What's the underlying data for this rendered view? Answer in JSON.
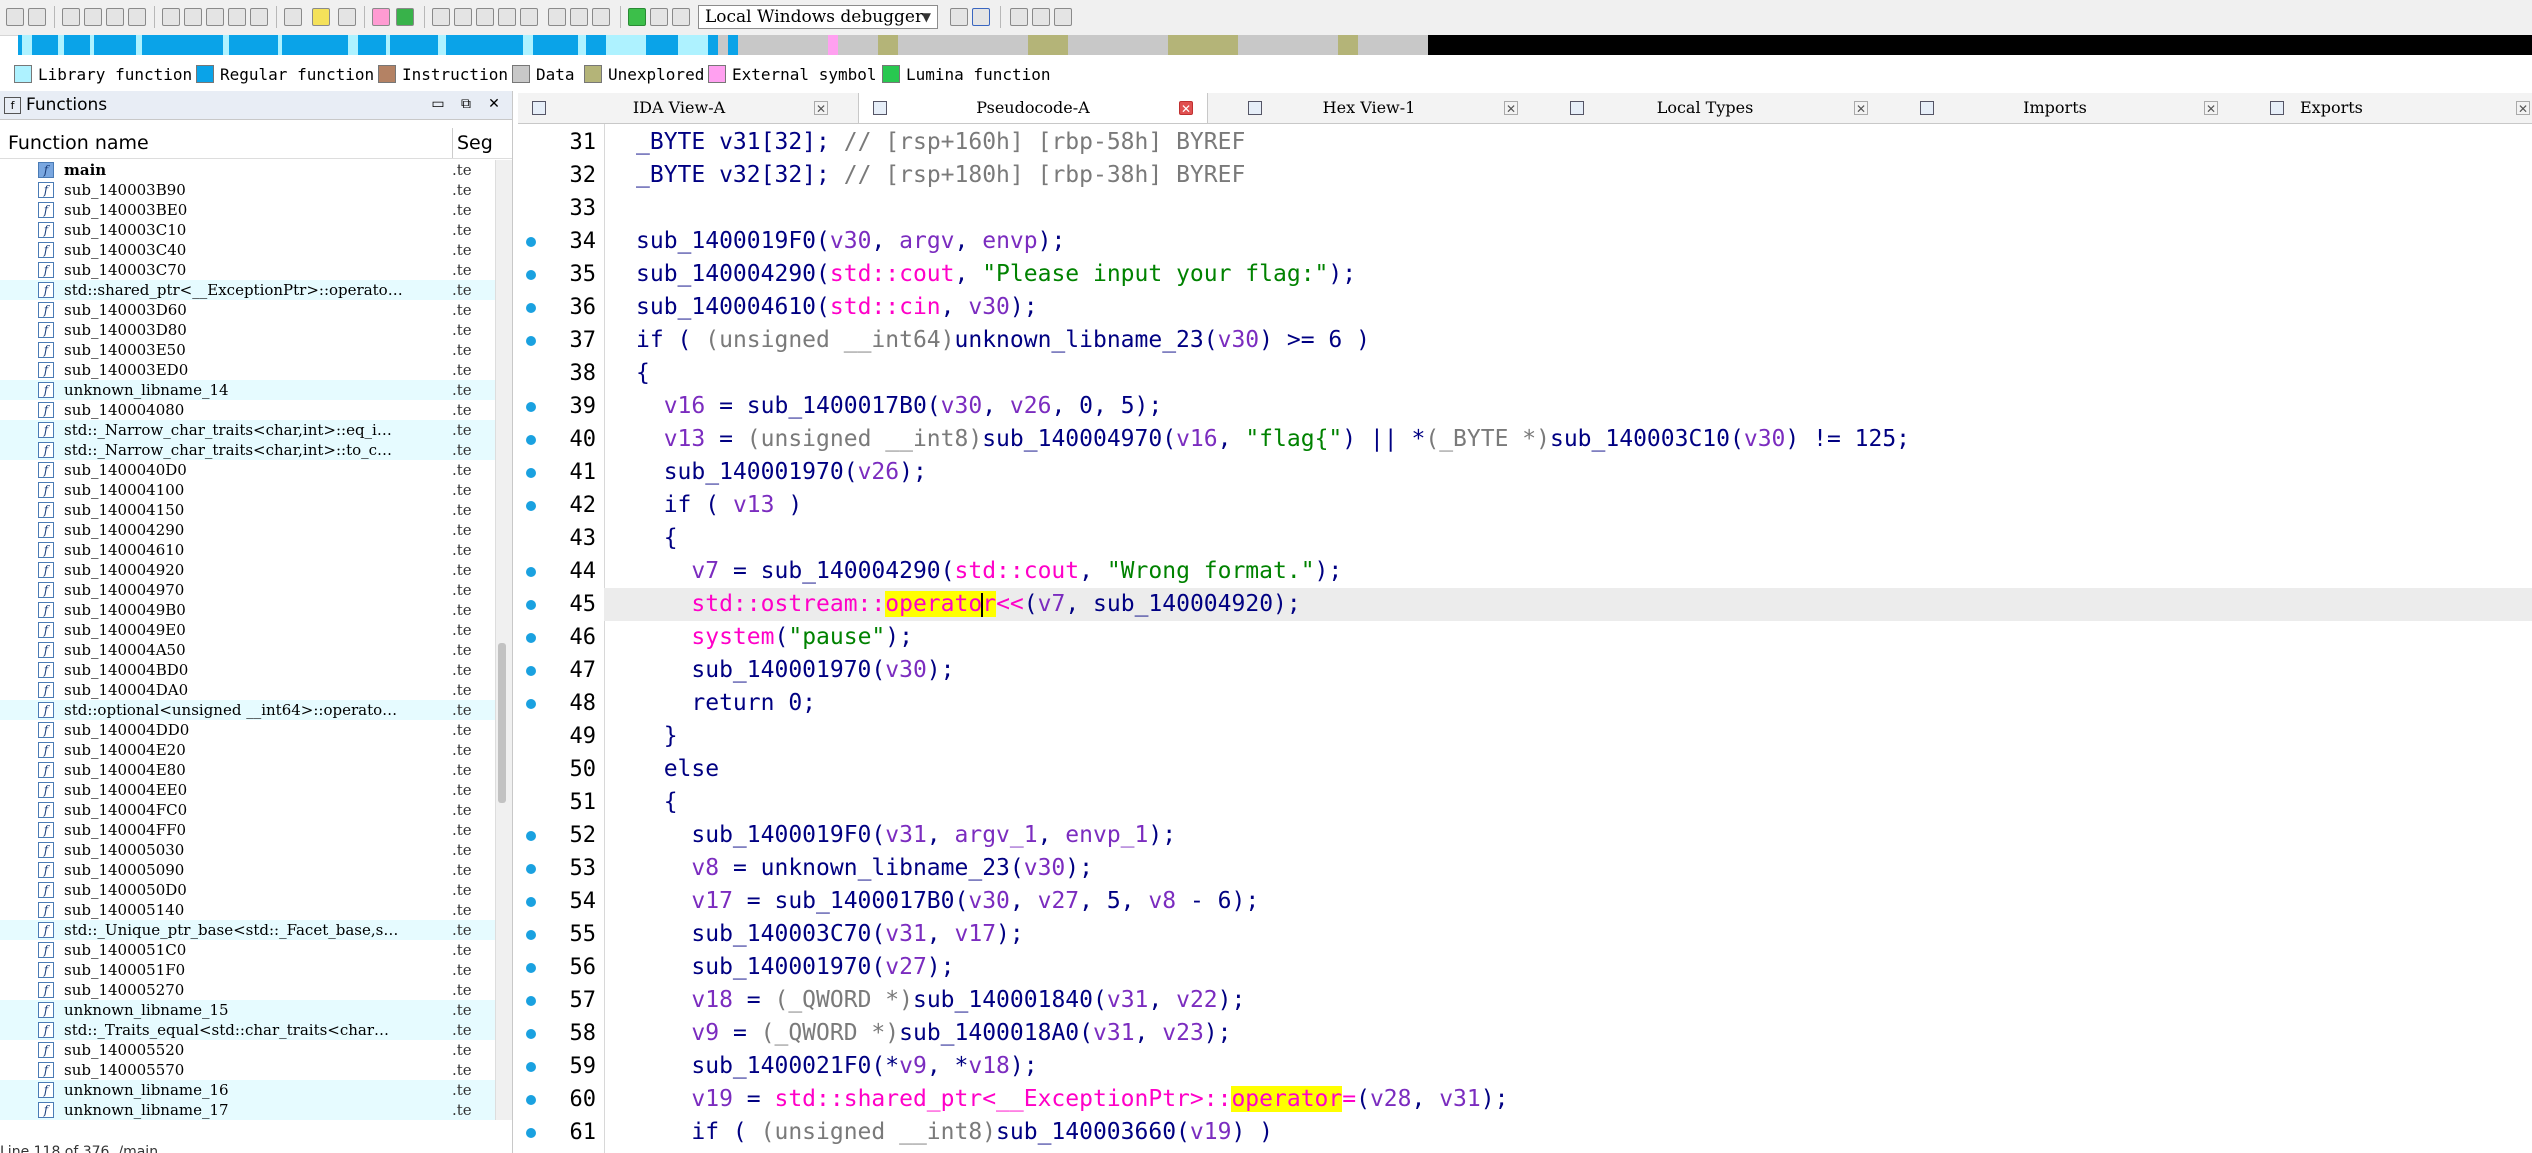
{
  "toolbar": {
    "debugger": "Local Windows debugger"
  },
  "legend": [
    {
      "label": "Library function",
      "color": "#aef2ff"
    },
    {
      "label": "Regular function",
      "color": "#0aa3e8"
    },
    {
      "label": "Instruction",
      "color": "#b48264"
    },
    {
      "label": "Data",
      "color": "#c8c8c8"
    },
    {
      "label": "Unexplored",
      "color": "#b4b478"
    },
    {
      "label": "External symbol",
      "color": "#ffa0f0"
    },
    {
      "label": "Lumina function",
      "color": "#28c850"
    }
  ],
  "functions_panel": {
    "title": "Functions",
    "col_name": "Function name",
    "col_seg": "Seg",
    "rows": [
      {
        "name": "main",
        "seg": ".te",
        "selected": true
      },
      {
        "name": "sub_140003B90",
        "seg": ".te"
      },
      {
        "name": "sub_140003BE0",
        "seg": ".te"
      },
      {
        "name": "sub_140003C10",
        "seg": ".te"
      },
      {
        "name": "sub_140003C40",
        "seg": ".te"
      },
      {
        "name": "sub_140003C70",
        "seg": ".te"
      },
      {
        "name": "std::shared_ptr<__ExceptionPtr>::operato…",
        "seg": ".te",
        "lib": true
      },
      {
        "name": "sub_140003D60",
        "seg": ".te"
      },
      {
        "name": "sub_140003D80",
        "seg": ".te"
      },
      {
        "name": "sub_140003E50",
        "seg": ".te"
      },
      {
        "name": "sub_140003ED0",
        "seg": ".te"
      },
      {
        "name": "unknown_libname_14",
        "seg": ".te",
        "lib": true
      },
      {
        "name": "sub_140004080",
        "seg": ".te"
      },
      {
        "name": "std::_Narrow_char_traits<char,int>::eq_i…",
        "seg": ".te",
        "lib": true
      },
      {
        "name": "std::_Narrow_char_traits<char,int>::to_c…",
        "seg": ".te",
        "lib": true
      },
      {
        "name": "sub_1400040D0",
        "seg": ".te"
      },
      {
        "name": "sub_140004100",
        "seg": ".te"
      },
      {
        "name": "sub_140004150",
        "seg": ".te"
      },
      {
        "name": "sub_140004290",
        "seg": ".te"
      },
      {
        "name": "sub_140004610",
        "seg": ".te"
      },
      {
        "name": "sub_140004920",
        "seg": ".te"
      },
      {
        "name": "sub_140004970",
        "seg": ".te"
      },
      {
        "name": "sub_1400049B0",
        "seg": ".te"
      },
      {
        "name": "sub_1400049E0",
        "seg": ".te"
      },
      {
        "name": "sub_140004A50",
        "seg": ".te"
      },
      {
        "name": "sub_140004BD0",
        "seg": ".te"
      },
      {
        "name": "sub_140004DA0",
        "seg": ".te"
      },
      {
        "name": "std::optional<unsigned __int64>::operato…",
        "seg": ".te",
        "lib": true
      },
      {
        "name": "sub_140004DD0",
        "seg": ".te"
      },
      {
        "name": "sub_140004E20",
        "seg": ".te"
      },
      {
        "name": "sub_140004E80",
        "seg": ".te"
      },
      {
        "name": "sub_140004EE0",
        "seg": ".te"
      },
      {
        "name": "sub_140004FC0",
        "seg": ".te"
      },
      {
        "name": "sub_140004FF0",
        "seg": ".te"
      },
      {
        "name": "sub_140005030",
        "seg": ".te"
      },
      {
        "name": "sub_140005090",
        "seg": ".te"
      },
      {
        "name": "sub_1400050D0",
        "seg": ".te"
      },
      {
        "name": "sub_140005140",
        "seg": ".te"
      },
      {
        "name": "std::_Unique_ptr_base<std::_Facet_base,s…",
        "seg": ".te",
        "lib": true
      },
      {
        "name": "sub_1400051C0",
        "seg": ".te"
      },
      {
        "name": "sub_1400051F0",
        "seg": ".te"
      },
      {
        "name": "sub_140005270",
        "seg": ".te"
      },
      {
        "name": "unknown_libname_15",
        "seg": ".te",
        "lib": true
      },
      {
        "name": "std::_Traits_equal<std::char_traits<char…",
        "seg": ".te",
        "lib": true
      },
      {
        "name": "sub_140005520",
        "seg": ".te"
      },
      {
        "name": "sub_140005570",
        "seg": ".te"
      },
      {
        "name": "unknown_libname_16",
        "seg": ".te",
        "lib": true
      },
      {
        "name": "unknown_libname_17",
        "seg": ".te",
        "lib": true
      }
    ],
    "status": "Line 118 of 376, /main"
  },
  "tabs": [
    {
      "label": "IDA View-A",
      "active": false
    },
    {
      "label": "Pseudocode-A",
      "active": true
    },
    {
      "label": "Hex View-1",
      "active": false
    },
    {
      "label": "Local Types",
      "active": false
    },
    {
      "label": "Imports",
      "active": false
    },
    {
      "label": "Exports",
      "active": false
    }
  ],
  "code": {
    "lines": [
      {
        "n": "31",
        "dot": false,
        "html": "<span class=\"k\">_BYTE v31[32];</span> <span class=\"c\">// [rsp+160h] [rbp-58h] BYREF</span>"
      },
      {
        "n": "32",
        "dot": false,
        "html": "<span class=\"k\">_BYTE v32[32];</span> <span class=\"c\">// [rsp+180h] [rbp-38h] BYREF</span>"
      },
      {
        "n": "33",
        "dot": false,
        "html": ""
      },
      {
        "n": "34",
        "dot": true,
        "html": "sub_1400019F0(<span class=\"v\">v30</span>, <span class=\"v\">argv</span>, <span class=\"v\">envp</span>);"
      },
      {
        "n": "35",
        "dot": true,
        "html": "sub_140004290(<span class=\"sd\">std::cout</span>, <span class=\"s\">\"Please input your flag:\"</span>);"
      },
      {
        "n": "36",
        "dot": true,
        "html": "sub_140004610(<span class=\"sd\">std::cin</span>, <span class=\"v\">v30</span>);"
      },
      {
        "n": "37",
        "dot": true,
        "html": "if ( <span class=\"c\">(unsigned __int64)</span>unknown_libname_23(<span class=\"v\">v30</span>) &gt;= 6 )"
      },
      {
        "n": "38",
        "dot": false,
        "html": "{"
      },
      {
        "n": "39",
        "dot": true,
        "html": "  <span class=\"v\">v16</span> = sub_1400017B0(<span class=\"v\">v30</span>, <span class=\"v\">v26</span>, 0, 5);"
      },
      {
        "n": "40",
        "dot": true,
        "html": "  <span class=\"v\">v13</span> = <span class=\"c\">(unsigned __int8)</span>sub_140004970(<span class=\"v\">v16</span>, <span class=\"s\">\"flag{\"</span>) || *<span class=\"c\">(_BYTE *)</span>sub_140003C10(<span class=\"v\">v30</span>) != 125;"
      },
      {
        "n": "41",
        "dot": true,
        "html": "  sub_140001970(<span class=\"v\">v26</span>);"
      },
      {
        "n": "42",
        "dot": true,
        "html": "  if ( <span class=\"v\">v13</span> )"
      },
      {
        "n": "43",
        "dot": false,
        "html": "  {"
      },
      {
        "n": "44",
        "dot": true,
        "html": "    <span class=\"v\">v7</span> = sub_140004290(<span class=\"sd\">std::cout</span>, <span class=\"s\">\"Wrong format.\"</span>);"
      },
      {
        "n": "45",
        "dot": true,
        "cur": true,
        "html": "    <span class=\"sd\">std::ostream::<span class=\"hl\">operato<span class=\"caret\"></span>r</span>&lt;&lt;</span>(<span class=\"v\">v7</span>, sub_140004920);"
      },
      {
        "n": "46",
        "dot": true,
        "html": "    <span class=\"sd\">system</span>(<span class=\"s\">\"pause\"</span>);"
      },
      {
        "n": "47",
        "dot": true,
        "html": "    sub_140001970(<span class=\"v\">v30</span>);"
      },
      {
        "n": "48",
        "dot": true,
        "html": "    return 0;"
      },
      {
        "n": "49",
        "dot": false,
        "html": "  }"
      },
      {
        "n": "50",
        "dot": false,
        "html": "  else"
      },
      {
        "n": "51",
        "dot": false,
        "html": "  {"
      },
      {
        "n": "52",
        "dot": true,
        "html": "    sub_1400019F0(<span class=\"v\">v31</span>, <span class=\"v\">argv_1</span>, <span class=\"v\">envp_1</span>);"
      },
      {
        "n": "53",
        "dot": true,
        "html": "    <span class=\"v\">v8</span> = unknown_libname_23(<span class=\"v\">v30</span>);"
      },
      {
        "n": "54",
        "dot": true,
        "html": "    <span class=\"v\">v17</span> = sub_1400017B0(<span class=\"v\">v30</span>, <span class=\"v\">v27</span>, 5, <span class=\"v\">v8</span> - 6);"
      },
      {
        "n": "55",
        "dot": true,
        "html": "    sub_140003C70(<span class=\"v\">v31</span>, <span class=\"v\">v17</span>);"
      },
      {
        "n": "56",
        "dot": true,
        "html": "    sub_140001970(<span class=\"v\">v27</span>);"
      },
      {
        "n": "57",
        "dot": true,
        "html": "    <span class=\"v\">v18</span> = <span class=\"c\">(_QWORD *)</span>sub_140001840(<span class=\"v\">v31</span>, <span class=\"v\">v22</span>);"
      },
      {
        "n": "58",
        "dot": true,
        "html": "    <span class=\"v\">v9</span> = <span class=\"c\">(_QWORD *)</span>sub_1400018A0(<span class=\"v\">v31</span>, <span class=\"v\">v23</span>);"
      },
      {
        "n": "59",
        "dot": true,
        "html": "    sub_1400021F0(*<span class=\"v\">v9</span>, *<span class=\"v\">v18</span>);"
      },
      {
        "n": "60",
        "dot": true,
        "html": "    <span class=\"v\">v19</span> = <span class=\"sd\">std::shared_ptr&lt;__ExceptionPtr&gt;::<span class=\"hl\">operator</span>=</span>(<span class=\"v\">v28</span>, <span class=\"v\">v31</span>);"
      },
      {
        "n": "61",
        "dot": true,
        "html": "    if ( <span class=\"c\">(unsigned __int8)</span>sub_140003660(<span class=\"v\">v19</span>) )"
      }
    ]
  }
}
